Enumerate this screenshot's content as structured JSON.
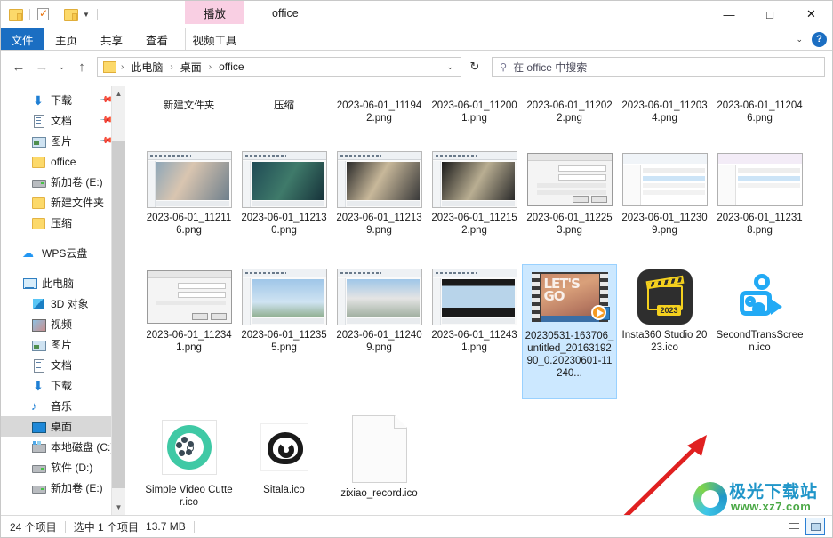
{
  "window": {
    "title": "office",
    "quick_access": [
      "folder-icon",
      "properties-icon",
      "new-folder-icon",
      "dropdown-caret"
    ],
    "controls": {
      "minimize": "—",
      "maximize": "□",
      "close": "✕"
    }
  },
  "ribbon": {
    "tabs": [
      {
        "label": "文件",
        "active": true
      },
      {
        "label": "主页",
        "active": false
      },
      {
        "label": "共享",
        "active": false
      },
      {
        "label": "查看",
        "active": false
      }
    ],
    "contextual": {
      "group_label": "视频工具",
      "tab_label": "播放",
      "highlight_color": "#f9cfe3"
    },
    "help_label": "?",
    "collapse_caret": "⌄"
  },
  "address_bar": {
    "back": "←",
    "forward": "→",
    "history": "⌄",
    "up": "↑",
    "breadcrumb": [
      "此电脑",
      "桌面",
      "office"
    ],
    "separator": "›",
    "dropdown": "⌄",
    "refresh": "↻"
  },
  "search": {
    "icon": "search-icon",
    "placeholder": "在 office 中搜索"
  },
  "sidebar": {
    "items": [
      {
        "label": "下载",
        "icon": "download-icon",
        "level": 2,
        "pinned": true,
        "selected": false
      },
      {
        "label": "文档",
        "icon": "document-icon",
        "level": 2,
        "pinned": true,
        "selected": false
      },
      {
        "label": "图片",
        "icon": "pictures-icon",
        "level": 2,
        "pinned": true,
        "selected": false
      },
      {
        "label": "office",
        "icon": "folder-icon",
        "level": 2,
        "pinned": false,
        "selected": false
      },
      {
        "label": "新加卷 (E:)",
        "icon": "drive-icon",
        "level": 2,
        "pinned": false,
        "selected": false
      },
      {
        "label": "新建文件夹",
        "icon": "folder-icon",
        "level": 2,
        "pinned": false,
        "selected": false
      },
      {
        "label": "压缩",
        "icon": "folder-icon",
        "level": 2,
        "pinned": false,
        "selected": false
      },
      {
        "label": "WPS云盘",
        "icon": "cloud-icon",
        "level": 1,
        "pinned": false,
        "selected": false,
        "spacer_before": true
      },
      {
        "label": "此电脑",
        "icon": "computer-icon",
        "level": 1,
        "pinned": false,
        "selected": false,
        "spacer_before": true
      },
      {
        "label": "3D 对象",
        "icon": "3d-objects-icon",
        "level": 2,
        "pinned": false,
        "selected": false
      },
      {
        "label": "视频",
        "icon": "videos-icon",
        "level": 2,
        "pinned": false,
        "selected": false
      },
      {
        "label": "图片",
        "icon": "pictures-icon",
        "level": 2,
        "pinned": false,
        "selected": false
      },
      {
        "label": "文档",
        "icon": "document-icon",
        "level": 2,
        "pinned": false,
        "selected": false
      },
      {
        "label": "下载",
        "icon": "download-icon",
        "level": 2,
        "pinned": false,
        "selected": false
      },
      {
        "label": "音乐",
        "icon": "music-icon",
        "level": 2,
        "pinned": false,
        "selected": false
      },
      {
        "label": "桌面",
        "icon": "desktop-icon",
        "level": 2,
        "pinned": false,
        "selected": true
      },
      {
        "label": "本地磁盘 (C:)",
        "icon": "system-drive-icon",
        "level": 2,
        "pinned": false,
        "selected": false
      },
      {
        "label": "软件 (D:)",
        "icon": "drive-icon",
        "level": 2,
        "pinned": false,
        "selected": false
      },
      {
        "label": "新加卷 (E:)",
        "icon": "drive-icon",
        "level": 2,
        "pinned": false,
        "selected": false
      }
    ]
  },
  "files": {
    "row1": [
      {
        "name": "新建文件夹",
        "kind": "folder-partial",
        "selected": false
      },
      {
        "name": "压缩",
        "kind": "folder-partial",
        "selected": false
      },
      {
        "name": "2023-06-01_111942.png",
        "kind": "image-partial",
        "selected": false
      },
      {
        "name": "2023-06-01_112001.png",
        "kind": "image-partial",
        "selected": false
      },
      {
        "name": "2023-06-01_112022.png",
        "kind": "image-partial",
        "selected": false
      },
      {
        "name": "2023-06-01_112034.png",
        "kind": "image-partial",
        "selected": false
      },
      {
        "name": "2023-06-01_112046.png",
        "kind": "image-partial",
        "selected": false
      }
    ],
    "row2": [
      {
        "name": "2023-06-01_112116.png",
        "kind": "video-editor-shot",
        "selected": false
      },
      {
        "name": "2023-06-01_112130.png",
        "kind": "video-editor-shot",
        "selected": false
      },
      {
        "name": "2023-06-01_112139.png",
        "kind": "video-editor-shot",
        "selected": false
      },
      {
        "name": "2023-06-01_112152.png",
        "kind": "video-editor-shot",
        "selected": false
      },
      {
        "name": "2023-06-01_112253.png",
        "kind": "dialog-shot",
        "selected": false
      },
      {
        "name": "2023-06-01_112309.png",
        "kind": "explorer-shot",
        "selected": false
      },
      {
        "name": "2023-06-01_112318.png",
        "kind": "explorer-shot",
        "selected": false
      }
    ],
    "row3": [
      {
        "name": "2023-06-01_112341.png",
        "kind": "dialog-shot",
        "selected": false
      },
      {
        "name": "2023-06-01_112355.png",
        "kind": "video-editor-shot",
        "selected": false
      },
      {
        "name": "2023-06-01_112409.png",
        "kind": "video-editor-shot",
        "selected": false
      },
      {
        "name": "2023-06-01_112431.png",
        "kind": "video-editor-shot",
        "selected": false
      },
      {
        "name": "20230531-163706_untitled_2016319290_0.20230601-11240...",
        "kind": "video-file",
        "selected": true,
        "thumb_text": "LET'S GO"
      },
      {
        "name": "Insta360 Studio 2023.ico",
        "kind": "insta360-icon",
        "selected": false
      },
      {
        "name": "SecondTransScreen.ico",
        "kind": "camera-icon",
        "selected": false
      }
    ],
    "row4": [
      {
        "name": "Simple Video Cutter.ico",
        "kind": "video-cutter-icon",
        "selected": false
      },
      {
        "name": "Sitala.ico",
        "kind": "sitala-icon",
        "selected": false
      },
      {
        "name": "zixiao_record.ico",
        "kind": "blank-doc-icon",
        "selected": false
      }
    ]
  },
  "status": {
    "item_count": "24 个项目",
    "selection": "选中 1 个项目",
    "size": "13.7 MB",
    "views": [
      "details-view",
      "large-icons-view"
    ]
  },
  "watermark": {
    "title": "极光下载站",
    "url": "www.xz7.com"
  },
  "annotation": {
    "type": "red-arrow",
    "color": "#e02020"
  }
}
